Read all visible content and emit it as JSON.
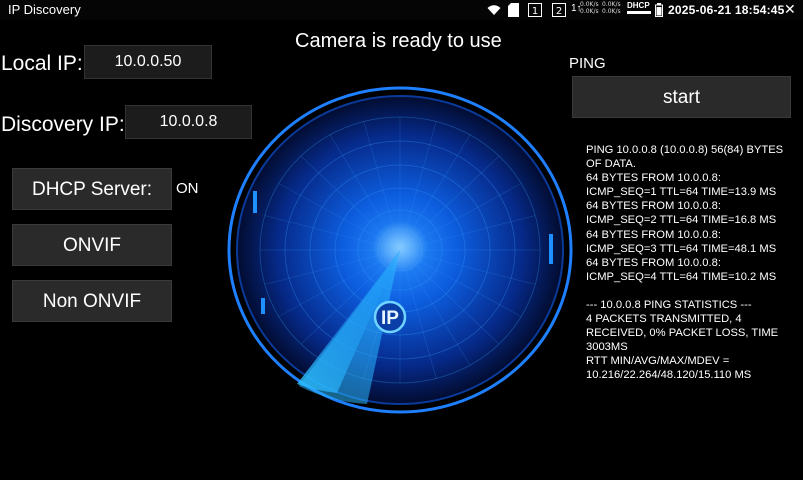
{
  "status_bar": {
    "app_title": "IP Discovery",
    "speed_up": "0.0K/s",
    "speed_down": "0.0K/s",
    "speed_up2": "0.0K/s",
    "speed_down2": "0.0K/s",
    "dhcp_badge": "DHCP",
    "datetime": "2025-06-21 18:54:45",
    "icons": [
      "wifi-icon",
      "sd-card-icon",
      "numeric-1-icon",
      "numeric-2-icon",
      "network-speed-icon",
      "battery-icon",
      "close-icon"
    ]
  },
  "headline": "Camera is ready to use",
  "local_ip": {
    "label": "Local IP:",
    "value": "10.0.0.50"
  },
  "discovery_ip": {
    "label": "Discovery IP:",
    "value": "10.0.0.8"
  },
  "dhcp_server": {
    "label": "DHCP Server:",
    "state": "ON"
  },
  "onvif_button": "ONVIF",
  "non_onvif_button": "Non ONVIF",
  "radar": {
    "center_label": "IP",
    "accent": "#1e7fff"
  },
  "ping": {
    "title": "PING",
    "start_label": "start",
    "log": [
      "PING 10.0.0.8 (10.0.0.8) 56(84) BYTES OF DATA.",
      "64 BYTES FROM 10.0.0.8: ICMP_SEQ=1 TTL=64 TIME=13.9 MS",
      "64 BYTES FROM 10.0.0.8: ICMP_SEQ=2 TTL=64 TIME=16.8 MS",
      "64 BYTES FROM 10.0.0.8: ICMP_SEQ=3 TTL=64 TIME=48.1 MS",
      "64 BYTES FROM 10.0.0.8: ICMP_SEQ=4 TTL=64 TIME=10.2 MS",
      "",
      "--- 10.0.0.8 PING STATISTICS ---",
      "4 PACKETS TRANSMITTED, 4 RECEIVED, 0% PACKET LOSS, TIME 3003MS",
      "RTT MIN/AVG/MAX/MDEV = 10.216/22.264/48.120/15.110 MS"
    ]
  }
}
